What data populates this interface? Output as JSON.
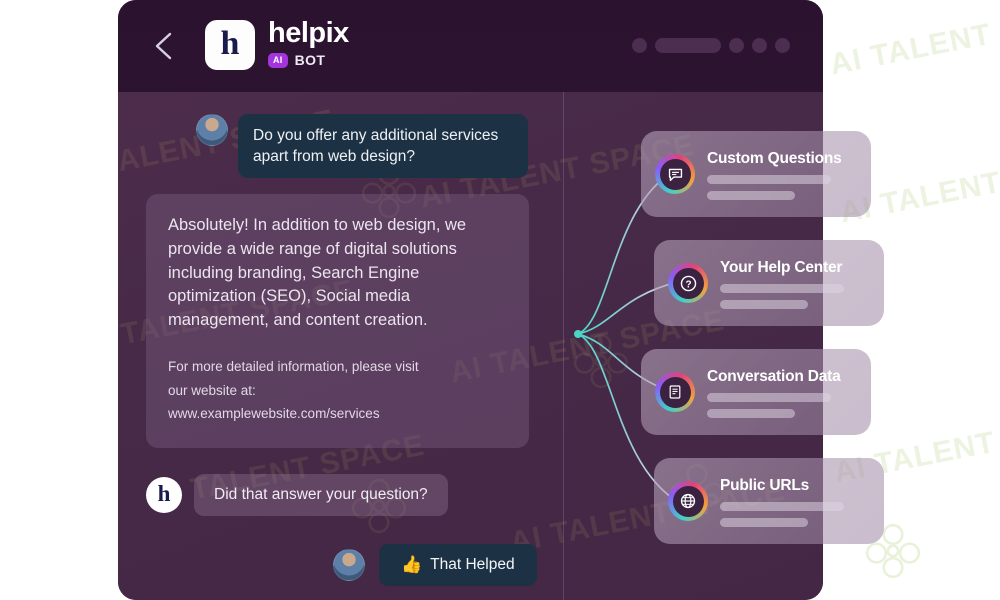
{
  "header": {
    "back_icon": "chevron-left-icon",
    "logo_letter": "h",
    "brand_name": "helpix",
    "ai_badge": "AI",
    "bot_label": "BOT",
    "controls": [
      "dot",
      "pill",
      "dot",
      "dot",
      "dot"
    ]
  },
  "conversation": {
    "user_message": "Do you offer any additional services apart from web design?",
    "bot_message": "Absolutely! In addition to web design, we provide a wide range of digital solutions including branding, Search Engine optimization (SEO), Social media management, and content creation.",
    "bot_followup_lines": [
      "For more detailed information, please visit",
      "our website at:",
      "www.examplewebsite.com/services"
    ],
    "bot_avatar_letter": "h",
    "followup_question": "Did that answer your question?",
    "helped_button": {
      "emoji": "👍",
      "label": "That Helped"
    }
  },
  "feature_cards": [
    {
      "title": "Custom Questions",
      "icon": "chat-bubble-icon"
    },
    {
      "title": "Your Help Center",
      "icon": "question-mark-icon"
    },
    {
      "title": "Conversation Data",
      "icon": "document-icon"
    },
    {
      "title": "Public URLs",
      "icon": "globe-icon"
    }
  ],
  "watermark": {
    "text": "AI TALENT SPACE"
  },
  "colors": {
    "window_bg": "#4a2c4a",
    "header_bg": "#2c1431",
    "user_bubble": "#1d3145",
    "accent_purple": "#a435dd",
    "connector_teal": "#4bd6c4"
  }
}
